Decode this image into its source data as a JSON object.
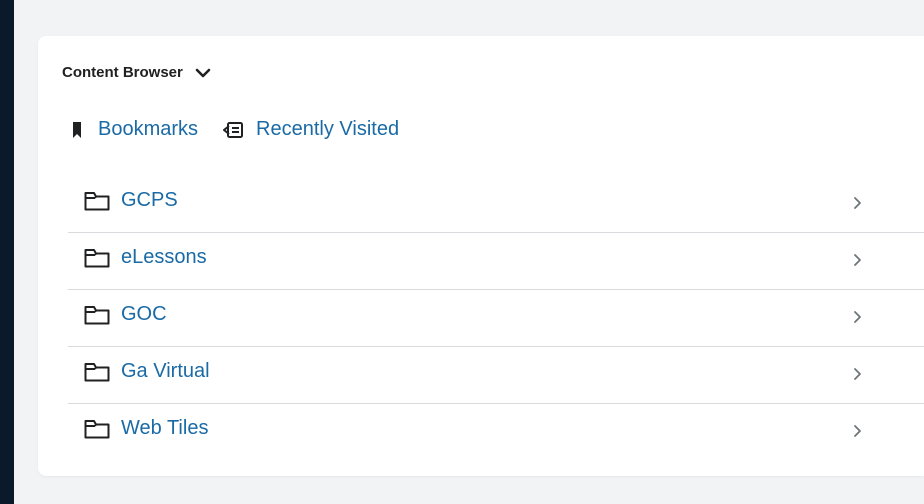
{
  "content_browser": {
    "title": "Content Browser",
    "quick_links": [
      {
        "label": "Bookmarks",
        "icon": "bookmark-icon"
      },
      {
        "label": "Recently Visited",
        "icon": "recently-visited-icon"
      }
    ],
    "folders": [
      {
        "label": "GCPS",
        "icon": "folder-icon"
      },
      {
        "label": "eLessons",
        "icon": "folder-icon"
      },
      {
        "label": "GOC",
        "icon": "folder-icon",
        "highlighted": true
      },
      {
        "label": "Ga Virtual",
        "icon": "folder-icon"
      },
      {
        "label": "Web Tiles",
        "icon": "folder-icon"
      }
    ]
  },
  "colors": {
    "background": "#0b1a2b",
    "panel": "#f2f3f5",
    "card": "#ffffff",
    "link": "#1a6aa5",
    "highlight": "#ffff00",
    "divider": "#d8dadd"
  }
}
